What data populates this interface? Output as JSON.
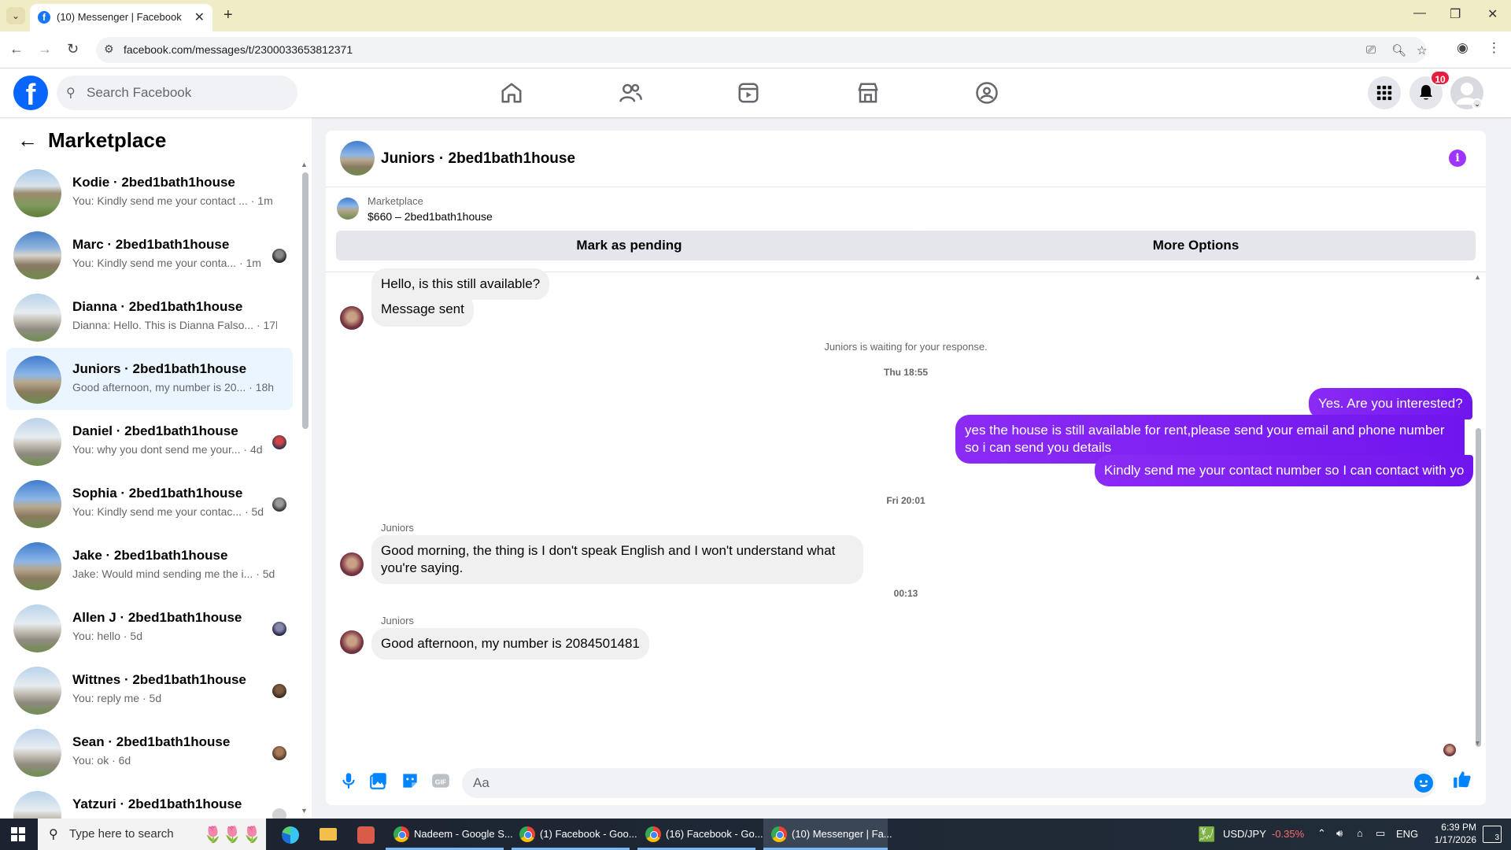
{
  "browser": {
    "tab_title": "(10) Messenger | Facebook",
    "url": "facebook.com/messages/t/2300033653812371"
  },
  "fb": {
    "logo": "f",
    "search_placeholder": "Search Facebook",
    "notification_count": "10"
  },
  "left": {
    "title": "Marketplace",
    "conversations": [
      {
        "name": "Kodie · 2bed1bath1house",
        "snippet": "You: Kindly send me your contact ...",
        "time": "· 1m"
      },
      {
        "name": "Marc · 2bed1bath1house",
        "snippet": "You: Kindly send me your conta...",
        "time": "· 1m"
      },
      {
        "name": "Dianna · 2bed1bath1house",
        "snippet": "Dianna: Hello. This is Dianna Falso...",
        "time": "· 17h"
      },
      {
        "name": "Juniors · 2bed1bath1house",
        "snippet": "Good afternoon, my number is 20...",
        "time": "· 18h"
      },
      {
        "name": "Daniel · 2bed1bath1house",
        "snippet": "You: why you dont send me your...",
        "time": "· 4d"
      },
      {
        "name": "Sophia · 2bed1bath1house",
        "snippet": "You: Kindly send me your contac...",
        "time": "· 5d"
      },
      {
        "name": "Jake · 2bed1bath1house",
        "snippet": "Jake: Would mind sending me the i...",
        "time": "· 5d"
      },
      {
        "name": "Allen J · 2bed1bath1house",
        "snippet": "You: hello",
        "time": "· 5d"
      },
      {
        "name": "Wittnes · 2bed1bath1house",
        "snippet": "You: reply me",
        "time": "· 5d"
      },
      {
        "name": "Sean · 2bed1bath1house",
        "snippet": "You: ok",
        "time": "· 6d"
      },
      {
        "name": "Yatzuri · 2bed1bath1house",
        "snippet": "",
        "time": ""
      }
    ]
  },
  "chat": {
    "name": "Juniors · 2bed1bath1house",
    "marketplace_label": "Marketplace",
    "item": "$660 – 2bed1bath1house",
    "pending_button": "Mark as pending",
    "options_button": "More Options",
    "messages": {
      "m1": "Hello, is this still available?",
      "m2": "Message sent",
      "waiting": "Juniors is waiting for your response.",
      "ts1": "Thu 18:55",
      "o1": "Yes. Are you interested?",
      "o2": "yes the house is still available for rent,please send your email and phone number so i can send you details",
      "o3": "Kindly send me your contact number so I can contact with yo",
      "ts2": "Fri 20:01",
      "sender1": "Juniors",
      "i1": "Good morning, the thing is I don't speak English and I won't understand what you're saying.",
      "ts3": "00:13",
      "sender2": "Juniors",
      "i2": "Good afternoon, my number is 2084501481"
    },
    "composer_placeholder": "Aa"
  },
  "taskbar": {
    "search_placeholder": "Type here to search",
    "apps": [
      "Nadeem - Google S...",
      "(1) Facebook - Goo...",
      "(16) Facebook - Go...",
      "(10) Messenger | Fa..."
    ],
    "ticker": "USD/JPY",
    "ticker_change": "-0.35%",
    "lang": "ENG",
    "time": "6:39 PM",
    "date": "1/17/2026",
    "notif_count": "3"
  },
  "colors": {
    "fb_blue": "#0866ff",
    "outgoing_bubble": "#7b14f0",
    "active_conversation": "#ebf5ff",
    "badge_red": "#e41e3f"
  }
}
